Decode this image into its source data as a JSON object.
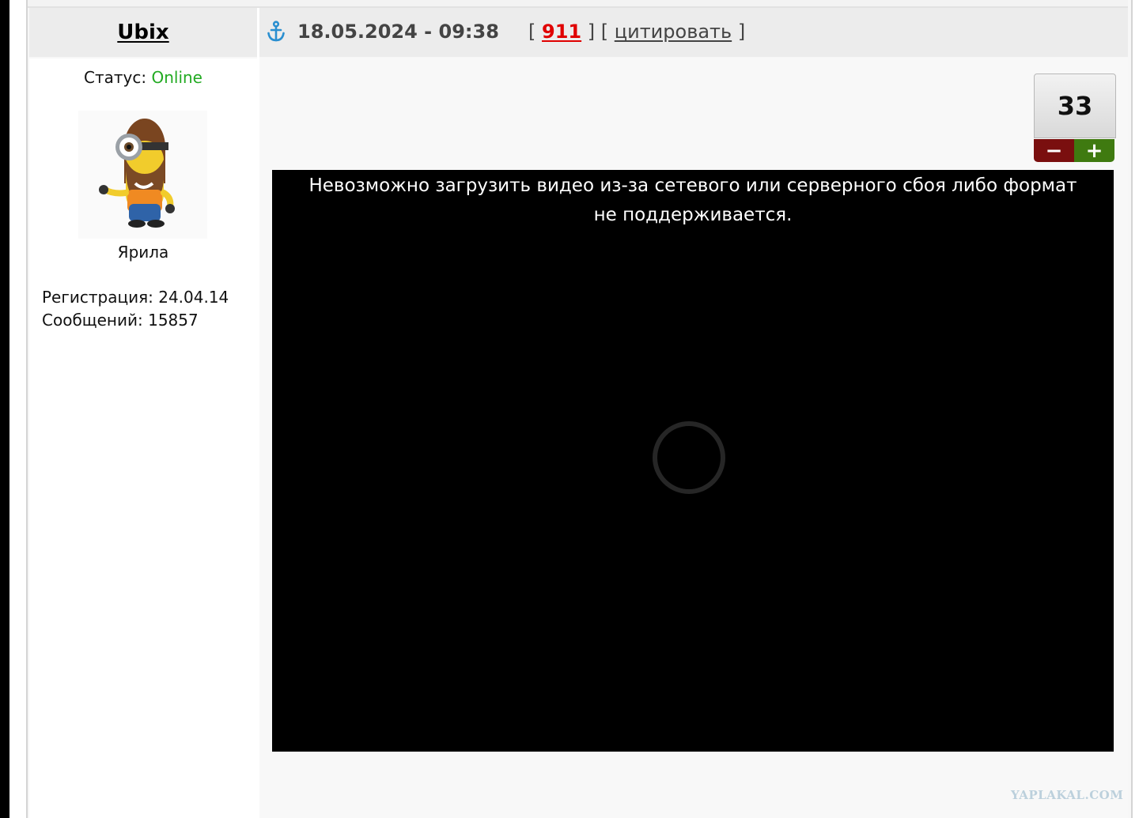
{
  "post": {
    "username": "Ubix",
    "date": "18.05.2024 - 09:38",
    "bracket_open": "[",
    "bracket_mid": "] [",
    "bracket_close": "]",
    "number": "911",
    "quote_label": "цитировать"
  },
  "user": {
    "status_label": "Статус:",
    "status_value": "Online",
    "rank": "Ярила",
    "registration_label": "Регистрация:",
    "registration_value": "24.04.14",
    "messages_label": "Сообщений:",
    "messages_value": "15857"
  },
  "rating": {
    "value": "33",
    "minus_label": "−",
    "plus_label": "+"
  },
  "video": {
    "error_message": "Невозможно загрузить видео из-за сетевого или серверного сбоя либо формат не поддерживается."
  },
  "watermark": "YAPLAKAL.COM",
  "icons": {
    "anchor": "anchor-icon",
    "avatar": "minion-avatar",
    "spinner": "loading-spinner-icon"
  },
  "colors": {
    "status_online": "#22aa22",
    "post_number": "#e00000",
    "vote_minus": "#7a0f0f",
    "vote_plus": "#3f7a10",
    "anchor": "#2a8fd0"
  }
}
